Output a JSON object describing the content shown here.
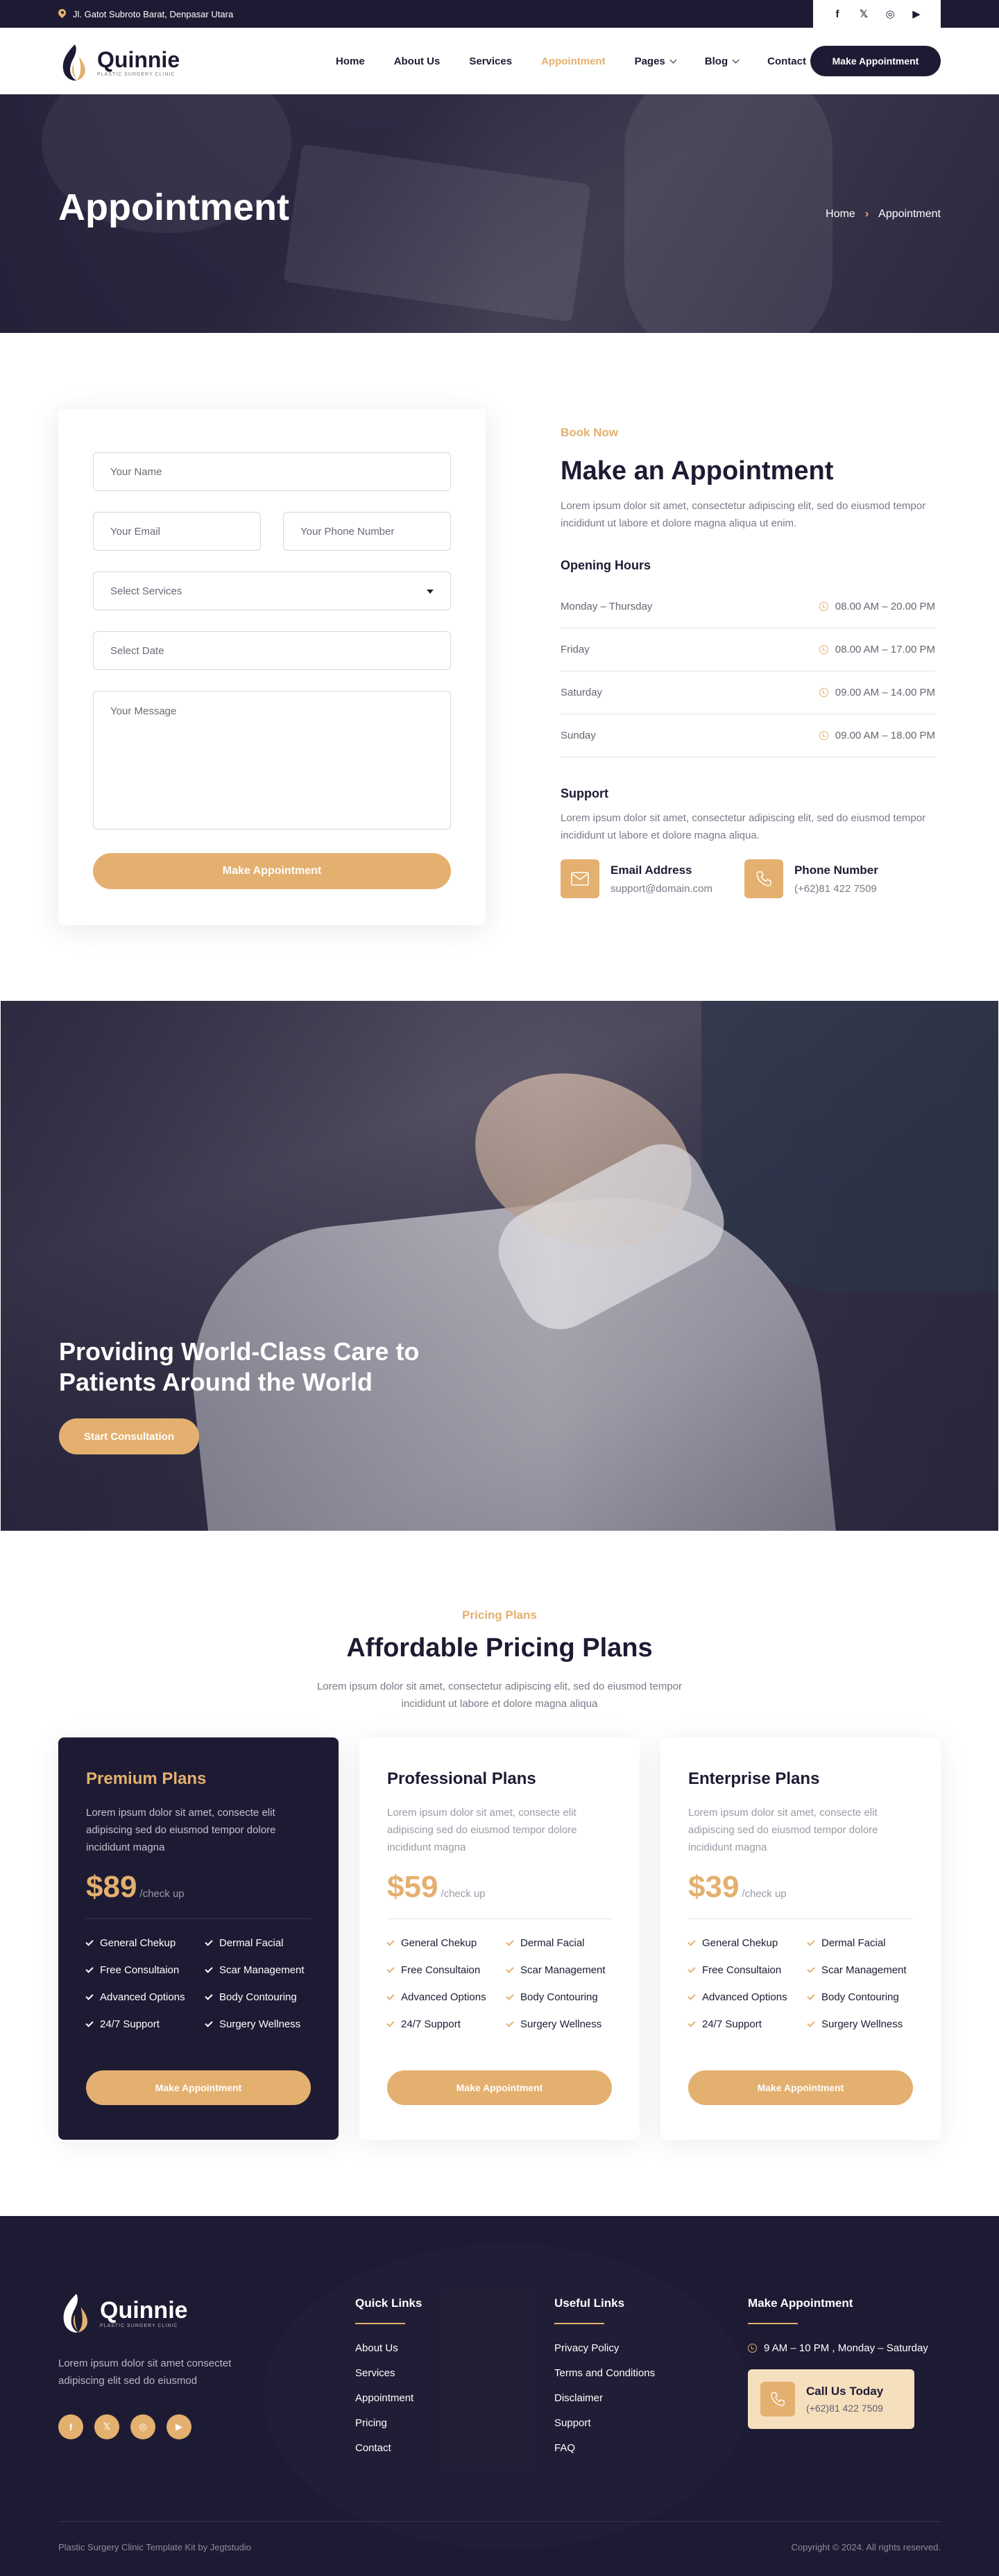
{
  "topbar": {
    "address": "Jl. Gatot Subroto Barat, Denpasar Utara",
    "social": [
      {
        "icon": "facebook-icon",
        "glyph": "f"
      },
      {
        "icon": "x-icon",
        "glyph": "𝕏"
      },
      {
        "icon": "instagram-icon",
        "glyph": "◎"
      },
      {
        "icon": "youtube-icon",
        "glyph": "▶"
      }
    ]
  },
  "header": {
    "brand": "Quinnie",
    "tagline": "PLASTIC SURGERY CLINIC",
    "nav": {
      "home": "Home",
      "about": "About Us",
      "services": "Services",
      "appointment": "Appointment",
      "pages": "Pages",
      "blog": "Blog",
      "contact": "Contact"
    },
    "cta": "Make Appointment"
  },
  "hero": {
    "title": "Appointment",
    "breadcrumb_home": "Home",
    "breadcrumb_sep": "›",
    "breadcrumb_current": "Appointment"
  },
  "form": {
    "name_placeholder": "Your Name",
    "email_placeholder": "Your Email",
    "phone_placeholder": "Your Phone Number",
    "services_placeholder": "Select Services",
    "date_placeholder": "Select Date",
    "message_placeholder": "Your Message",
    "submit": "Make Appointment"
  },
  "info": {
    "eyebrow": "Book Now",
    "title": "Make an Appointment",
    "description": "Lorem ipsum dolor sit amet, consectetur adipiscing elit, sed do eiusmod tempor incididunt ut labore et dolore magna aliqua ut enim.",
    "hours_title": "Opening Hours",
    "hours": [
      {
        "day": "Monday – Thursday",
        "time": "08.00 AM – 20.00 PM"
      },
      {
        "day": "Friday",
        "time": "08.00 AM – 17.00 PM"
      },
      {
        "day": "Saturday",
        "time": "09.00 AM – 14.00 PM"
      },
      {
        "day": "Sunday",
        "time": "09.00 AM – 18.00 PM"
      }
    ],
    "support_title": "Support",
    "support_text": "Lorem ipsum dolor sit amet, consectetur adipiscing elit, sed do eiusmod tempor incididunt ut labore et dolore magna aliqua.",
    "email_label": "Email Address",
    "email_value": "support@domain.com",
    "phone_label": "Phone Number",
    "phone_value": "(+62)81 422 7509"
  },
  "banner": {
    "title": "Providing World-Class Care to Patients Around the World",
    "cta": "Start Consultation"
  },
  "pricing": {
    "eyebrow": "Pricing Plans",
    "title": "Affordable Pricing Plans",
    "description": "Lorem ipsum dolor sit amet, consectetur adipiscing elit, sed do eiusmod tempor incididunt ut labore et dolore magna aliqua",
    "plans": [
      {
        "name": "Premium Plans",
        "description": "Lorem ipsum dolor sit amet, consecte elit adipiscing sed do eiusmod tempor dolore incididunt magna",
        "price": "$89",
        "per": "/check up",
        "features": [
          "General Chekup",
          "Dermal Facial",
          "Free Consultaion",
          "Scar Management",
          "Advanced Options",
          "Body Contouring",
          "24/7 Support",
          "Surgery Wellness"
        ],
        "cta": "Make Appointment"
      },
      {
        "name": "Professional Plans",
        "description": "Lorem ipsum dolor sit amet, consecte elit adipiscing sed do eiusmod tempor dolore incididunt magna",
        "price": "$59",
        "per": "/check up",
        "features": [
          "General Chekup",
          "Dermal Facial",
          "Free Consultaion",
          "Scar Management",
          "Advanced Options",
          "Body Contouring",
          "24/7 Support",
          "Surgery Wellness"
        ],
        "cta": "Make Appointment"
      },
      {
        "name": "Enterprise Plans",
        "description": "Lorem ipsum dolor sit amet, consecte elit adipiscing sed do eiusmod tempor dolore incididunt magna",
        "price": "$39",
        "per": "/check up",
        "features": [
          "General Chekup",
          "Dermal Facial",
          "Free Consultaion",
          "Scar Management",
          "Advanced Options",
          "Body Contouring",
          "24/7 Support",
          "Surgery Wellness"
        ],
        "cta": "Make Appointment"
      }
    ]
  },
  "footer": {
    "brand": "Quinnie",
    "tagline": "PLASTIC SURGERY CLINIC",
    "description": "Lorem ipsum dolor sit amet consectet adipiscing elit sed do eiusmod",
    "social": [
      {
        "icon": "facebook-icon",
        "glyph": "f"
      },
      {
        "icon": "x-icon",
        "glyph": "𝕏"
      },
      {
        "icon": "instagram-icon",
        "glyph": "◎"
      },
      {
        "icon": "youtube-icon",
        "glyph": "▶"
      }
    ],
    "quick_links_title": "Quick Links",
    "quick_links": [
      "About Us",
      "Services",
      "Appointment",
      "Pricing",
      "Contact"
    ],
    "useful_links_title": "Useful Links",
    "useful_links": [
      "Privacy Policy",
      "Terms and Conditions",
      "Disclaimer",
      "Support",
      "FAQ"
    ],
    "appointment_title": "Make Appointment",
    "hours": "9 AM – 10 PM , Monday – Saturday",
    "call_title": "Call Us Today",
    "call_number": "(+62)81 422 7509",
    "credit": "Plastic Surgery Clinic Template Kit by Jegtstudio",
    "copyright": "Copyright © 2024. All rights reserved."
  },
  "colors": {
    "dark": "#1d1b33",
    "gold": "#e4b06f",
    "gold_light": "#f6dfbd"
  }
}
